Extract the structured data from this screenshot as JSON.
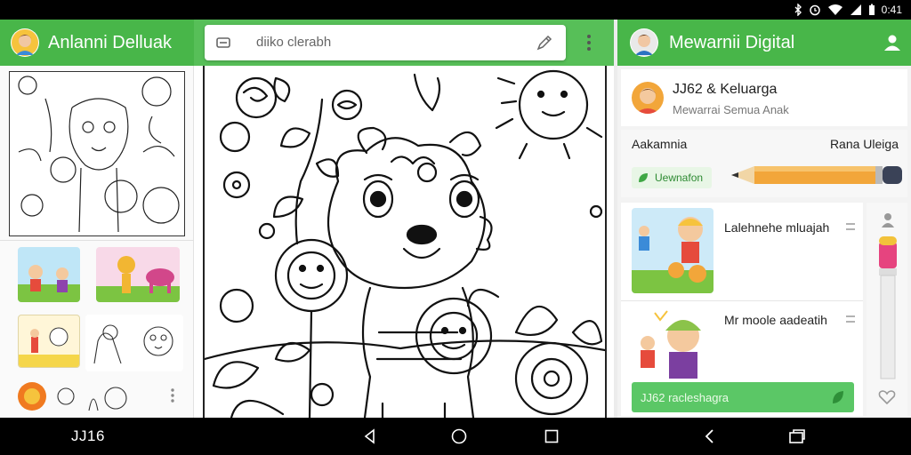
{
  "status": {
    "time": "0:41"
  },
  "left_header": {
    "title": "Anlanni Delluak"
  },
  "search": {
    "value": "diiko clerabh"
  },
  "right_header": {
    "title": "Mewarnii Digital"
  },
  "profile": {
    "name": "JJ62 & Keluarga",
    "subtitle": "Mewarrai Semua Anak"
  },
  "settings": {
    "left_label": "Aakamnia",
    "right_label": "Rana Uleiga",
    "button_label": "Uewnafon"
  },
  "list": {
    "items": [
      {
        "title": "Lalehnehe mluajah"
      },
      {
        "title": "Mr moole aadeatih"
      }
    ],
    "footer_label": "JJ62 racleshagra"
  },
  "nav": {
    "label": "JJ16"
  },
  "colors": {
    "brand": "#48b649",
    "accent_pencil": "#f2a63a"
  }
}
